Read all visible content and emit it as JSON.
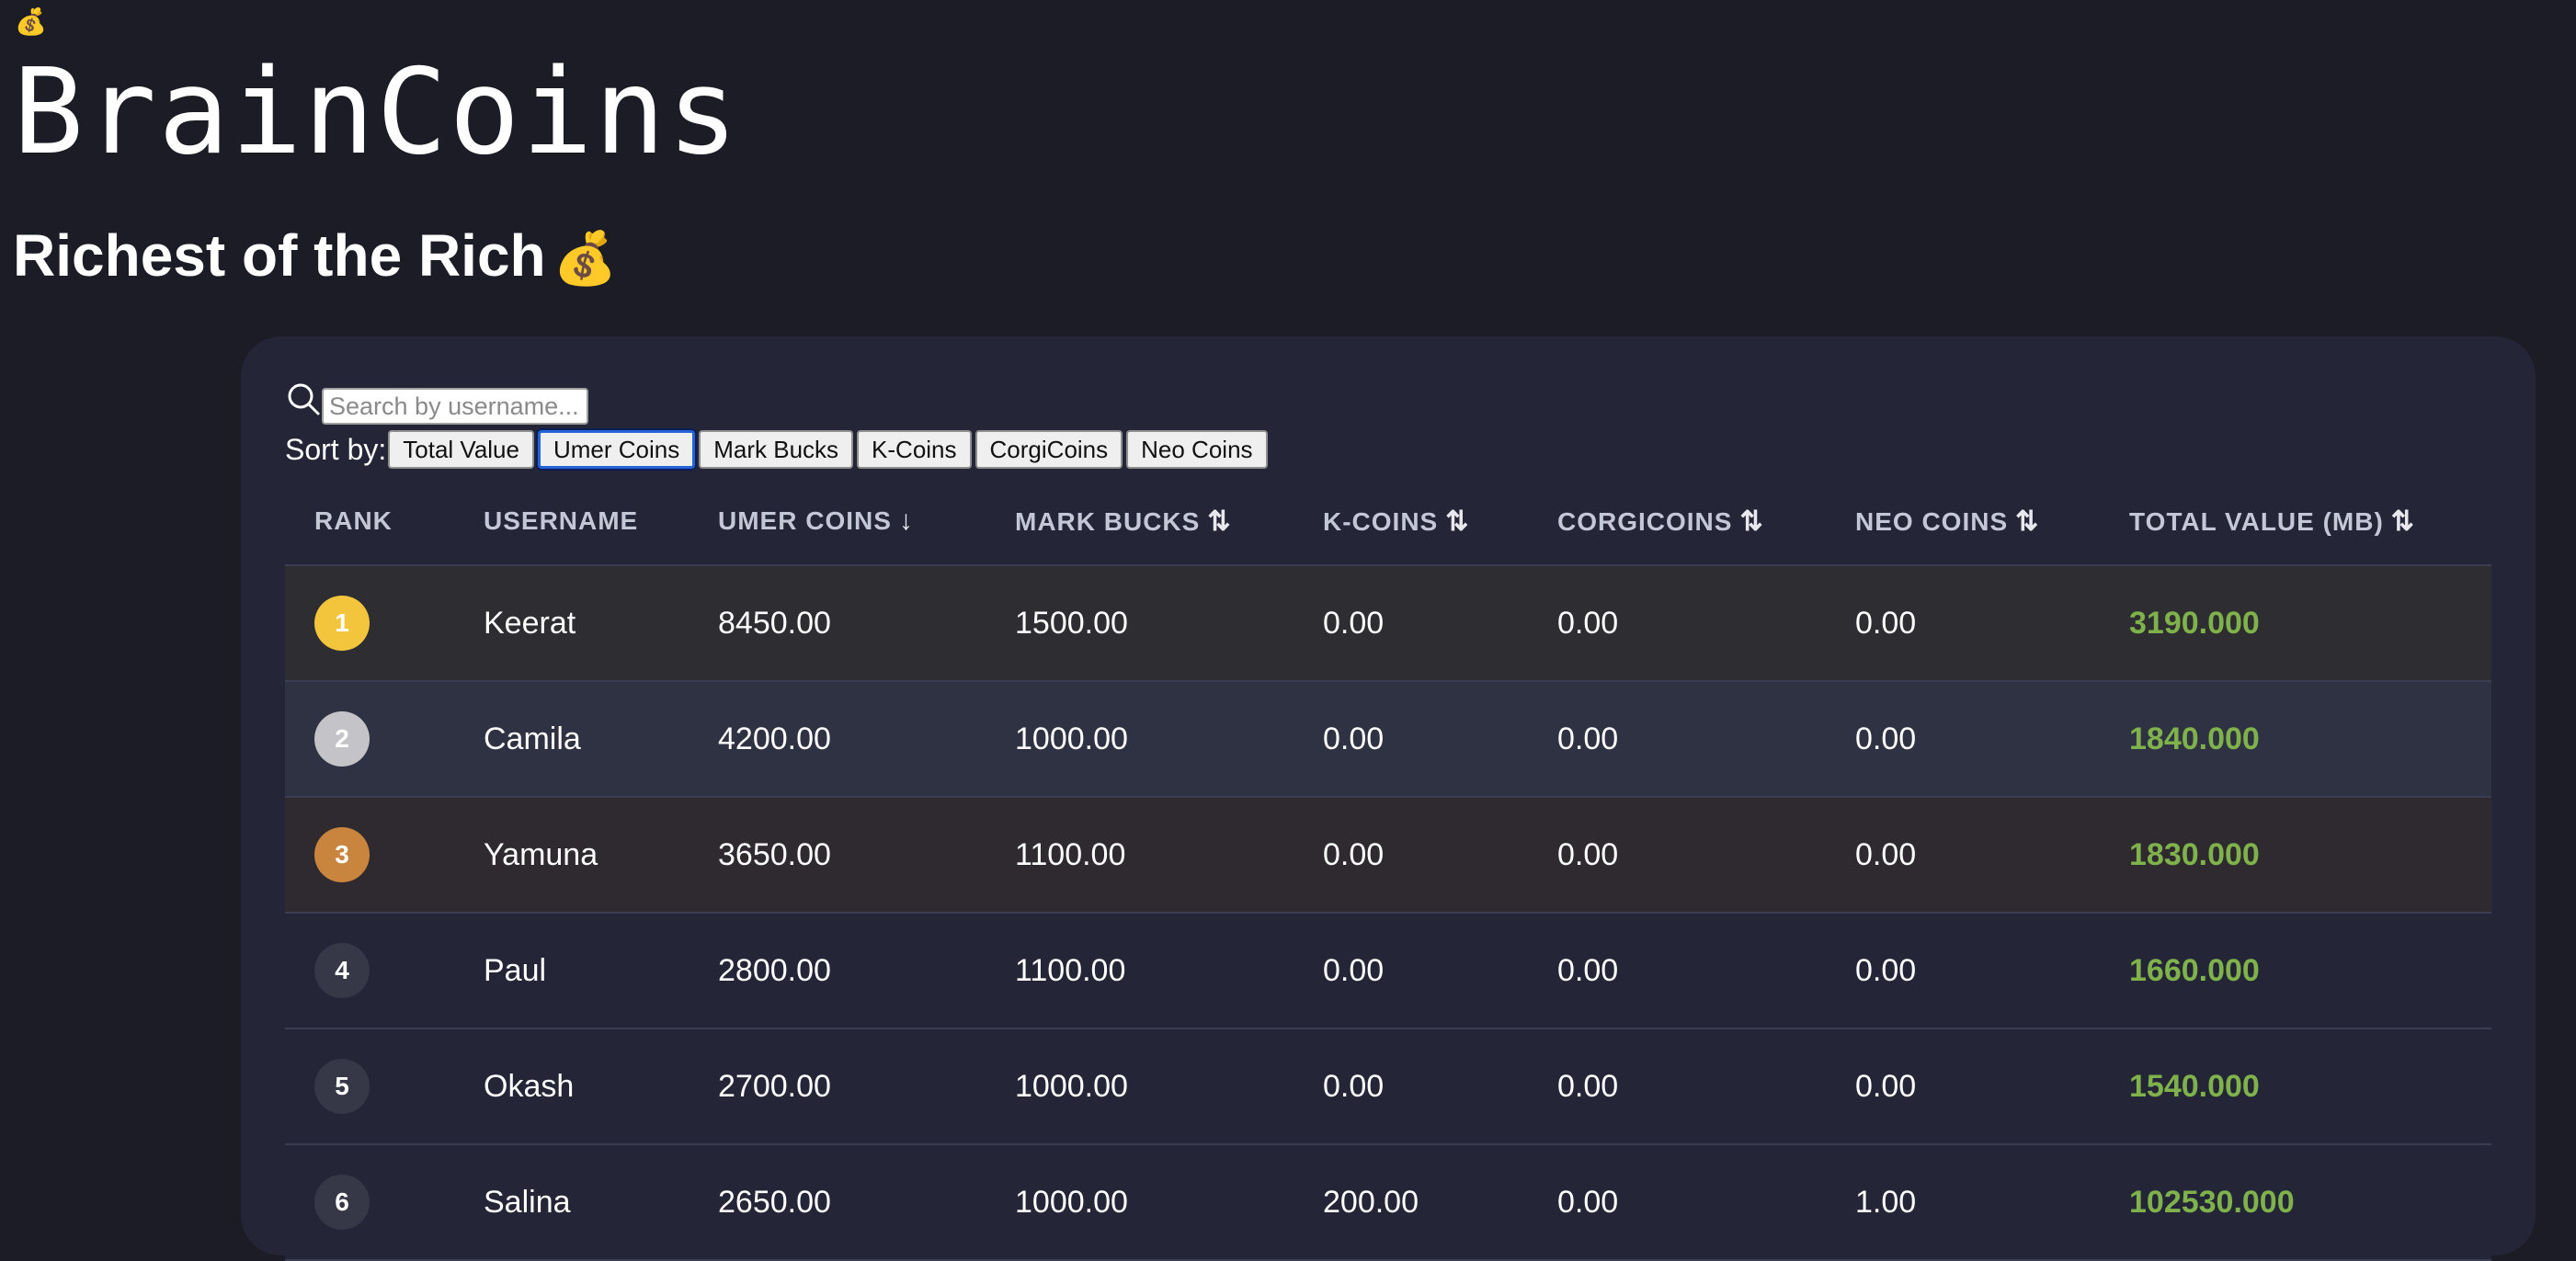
{
  "header": {
    "top_icon": "💰",
    "app_title": "BrainCoins",
    "subtitle": "Richest of the Rich",
    "subtitle_emoji": "💰"
  },
  "search": {
    "placeholder": "Search by username...",
    "icon": "search-icon"
  },
  "sort": {
    "label": "Sort by:",
    "active": "Umer Coins",
    "buttons": [
      "Total Value",
      "Umer Coins",
      "Mark Bucks",
      "K-Coins",
      "CorgiCoins",
      "Neo Coins"
    ]
  },
  "table": {
    "columns": [
      {
        "label": "RANK",
        "indicator": ""
      },
      {
        "label": "USERNAME",
        "indicator": ""
      },
      {
        "label": "UMER COINS",
        "indicator": "↓"
      },
      {
        "label": "MARK BUCKS",
        "indicator": "⇅"
      },
      {
        "label": "K-COINS",
        "indicator": "⇅"
      },
      {
        "label": "CORGICOINS",
        "indicator": "⇅"
      },
      {
        "label": "NEO COINS",
        "indicator": "⇅"
      },
      {
        "label": "TOTAL VALUE (MB)",
        "indicator": "⇅"
      }
    ],
    "rows": [
      {
        "rank": "1",
        "username": "Keerat",
        "umer": "8450.00",
        "mark": "1500.00",
        "k": "0.00",
        "corgi": "0.00",
        "neo": "0.00",
        "total": "3190.000"
      },
      {
        "rank": "2",
        "username": "Camila",
        "umer": "4200.00",
        "mark": "1000.00",
        "k": "0.00",
        "corgi": "0.00",
        "neo": "0.00",
        "total": "1840.000"
      },
      {
        "rank": "3",
        "username": "Yamuna",
        "umer": "3650.00",
        "mark": "1100.00",
        "k": "0.00",
        "corgi": "0.00",
        "neo": "0.00",
        "total": "1830.000"
      },
      {
        "rank": "4",
        "username": "Paul",
        "umer": "2800.00",
        "mark": "1100.00",
        "k": "0.00",
        "corgi": "0.00",
        "neo": "0.00",
        "total": "1660.000"
      },
      {
        "rank": "5",
        "username": "Okash",
        "umer": "2700.00",
        "mark": "1000.00",
        "k": "0.00",
        "corgi": "0.00",
        "neo": "0.00",
        "total": "1540.000"
      },
      {
        "rank": "6",
        "username": "Salina",
        "umer": "2650.00",
        "mark": "1000.00",
        "k": "200.00",
        "corgi": "0.00",
        "neo": "1.00",
        "total": "102530.000"
      }
    ]
  },
  "colors": {
    "background": "#1c1c26",
    "panel": "#242638",
    "gold": "#f2c53d",
    "silver": "#c4c4c8",
    "bronze": "#c9843e",
    "default_badge": "#363848",
    "total_value": "#7fb24a",
    "row_gold_bg": "#2d2d32",
    "row_silver_bg": "#2f3242",
    "row_bronze_bg": "#2e2a30"
  }
}
